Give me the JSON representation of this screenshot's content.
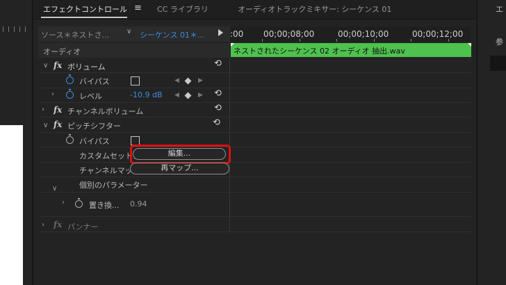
{
  "tabs": {
    "effect_controls": "エフェクトコントロール",
    "menu_icon": "≡",
    "cc_libraries": "CC ライブラリ",
    "audio_track_mixer": "オーディオトラックミキサー: シーケンス 01"
  },
  "source": {
    "label": "ソース＊ネストさ...",
    "sequence": "シーケンス 01＊...",
    "chevron": "❯"
  },
  "ruler": {
    "labels": [
      ":00",
      "00;00;08;00",
      "00;00;10;00",
      "00;00;12;00"
    ]
  },
  "clip": {
    "label": "ネストされたシーケンス 02 オーディオ 抽出.wav",
    "color": "#4ec24e"
  },
  "section": {
    "label": "オーディオ"
  },
  "effects": {
    "volume": {
      "name": "ボリューム",
      "bypass_label": "バイパス",
      "level_label": "レベル",
      "level_value": "-10.9 dB"
    },
    "channel_volume": {
      "name": "チャンネルボリューム"
    },
    "pitch_shifter": {
      "name": "ピッチシフター",
      "bypass_label": "バイパス",
      "custom_setup_label": "カスタムセットア",
      "edit_button": "編集...",
      "channel_map_label": "チャンネルマッ",
      "remap_button": "再マップ...",
      "params_label": "個別のパラメーター",
      "replace_label": "置き換...",
      "replace_value": "0.94"
    },
    "panner": {
      "name": "パンナー"
    }
  },
  "glyphs": {
    "fx": "fx",
    "chevron_down": "∨",
    "chevron_right": "›",
    "reset": "⟲",
    "kf_left": "◀",
    "kf_right": "▶"
  },
  "right": {
    "tab": "エ",
    "label": "参"
  },
  "colors": {
    "accent_blue": "#3d8ee0",
    "highlight_red": "#e01010"
  }
}
